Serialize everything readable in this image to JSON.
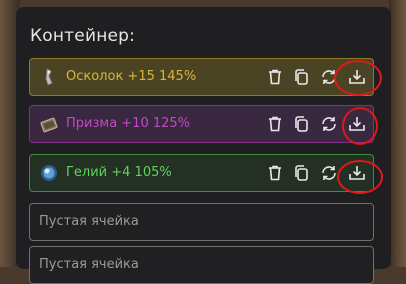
{
  "container": {
    "title": "Контейнер:",
    "slots": [
      {
        "name": "Осколок +15 145%",
        "color": "#d8b53a",
        "icon": "shard-icon"
      },
      {
        "name": "Призма +10 125%",
        "color": "#c04ac8",
        "icon": "prism-icon"
      },
      {
        "name": "Гелий +4 105%",
        "color": "#5fd35a",
        "icon": "helium-icon"
      }
    ],
    "empty_slots": [
      {
        "label": "Пустая ячейка"
      },
      {
        "label": "Пустая ячейка"
      }
    ]
  },
  "actions": [
    "trash-icon",
    "copy-icon",
    "swap-icon",
    "download-icon"
  ],
  "colors": {
    "panel": "#1f1f22",
    "annotation": "#e01818"
  }
}
